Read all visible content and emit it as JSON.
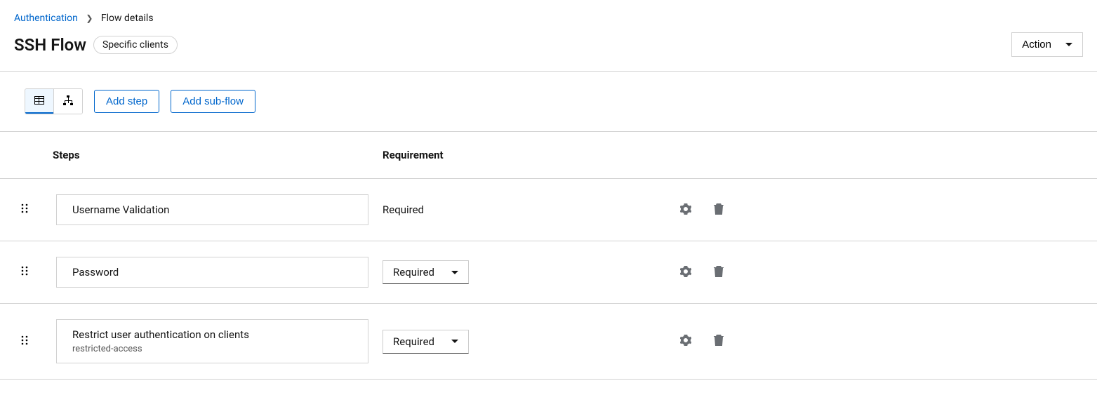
{
  "breadcrumb": {
    "parent": "Authentication",
    "current": "Flow details"
  },
  "header": {
    "title": "SSH Flow",
    "chip_label": "Specific clients",
    "action_label": "Action"
  },
  "toolbar": {
    "add_step_label": "Add step",
    "add_subflow_label": "Add sub-flow"
  },
  "columns": {
    "steps": "Steps",
    "requirement": "Requirement"
  },
  "rows": [
    {
      "name": "Username Validation",
      "alias": "",
      "requirement": "Required",
      "requirement_kind": "plain"
    },
    {
      "name": "Password",
      "alias": "",
      "requirement": "Required",
      "requirement_kind": "select"
    },
    {
      "name": "Restrict user authentication on clients",
      "alias": "restricted-access",
      "requirement": "Required",
      "requirement_kind": "select"
    }
  ]
}
